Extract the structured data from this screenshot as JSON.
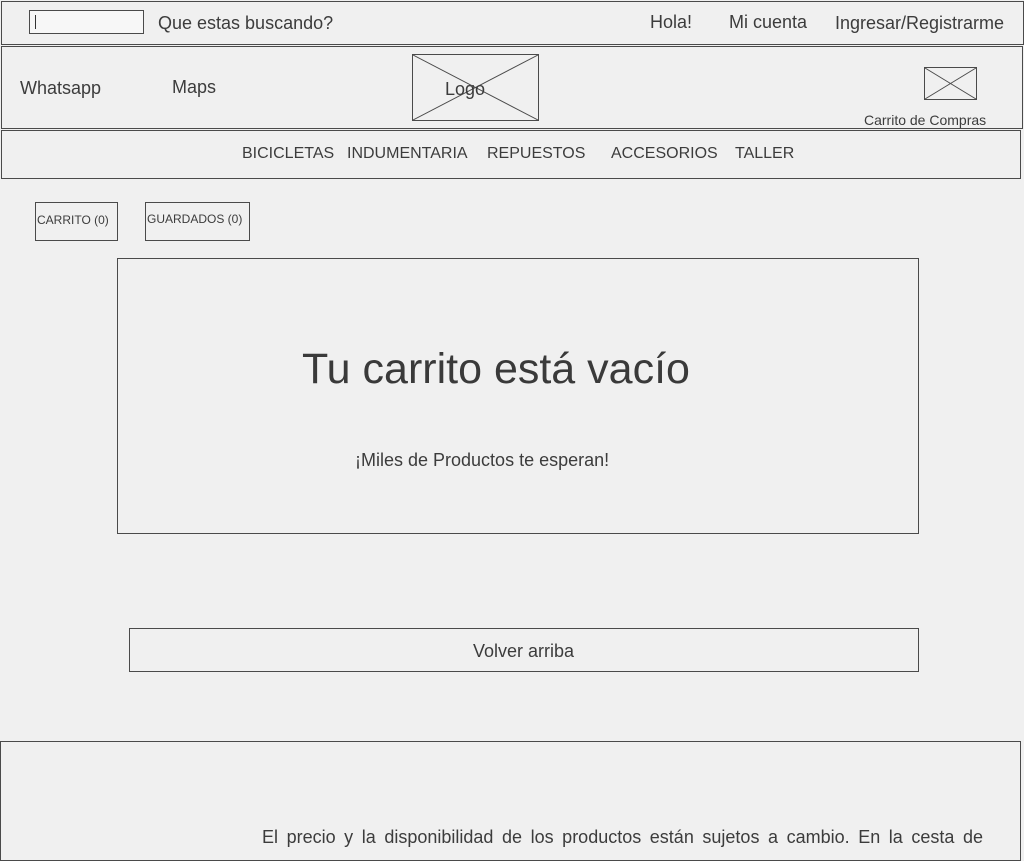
{
  "topbar": {
    "search_placeholder": "",
    "search_label": "Que estas buscando?",
    "greeting": "Hola!",
    "account": "Mi cuenta",
    "login": "Ingresar/Registrarme"
  },
  "header": {
    "whatsapp": "Whatsapp",
    "maps": "Maps",
    "logo": "Logo",
    "cart_label": "Carrito de Compras",
    "cart_icon": "cart-image-placeholder-icon"
  },
  "nav": {
    "items": [
      {
        "label": "BICICLETAS"
      },
      {
        "label": "INDUMENTARIA"
      },
      {
        "label": "REPUESTOS"
      },
      {
        "label": "ACCESORIOS"
      },
      {
        "label": "TALLER"
      }
    ]
  },
  "tabs": {
    "carrito": "CARRITO (0)",
    "guardados": "GUARDADOS (0)"
  },
  "empty_cart": {
    "title": "Tu carrito está vacío",
    "subtitle": "¡Miles de Productos te esperan!"
  },
  "back_to_top": "Volver arriba",
  "footer": {
    "note": "El precio y la disponibilidad de los productos están sujetos a cambio. En la cesta de"
  },
  "colors": {
    "background": "#f0f0f0",
    "border": "#4a4a4a",
    "text": "#3c3c3c"
  }
}
